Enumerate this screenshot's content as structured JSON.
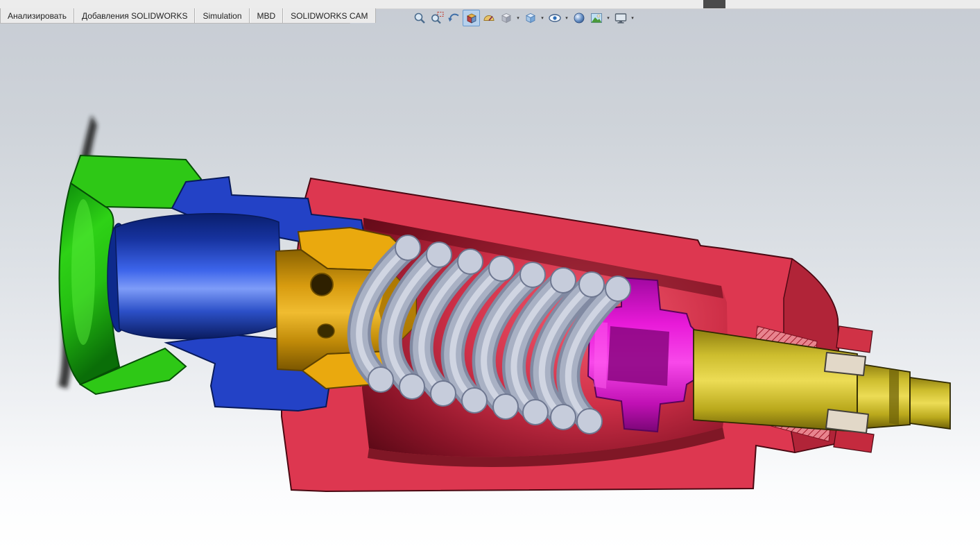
{
  "header": {
    "menubar_fragment": {
      "color": "#4a4a4a"
    },
    "tabs": [
      {
        "label": "Анализировать"
      },
      {
        "label": "Добавления SOLIDWORKS"
      },
      {
        "label": "Simulation"
      },
      {
        "label": "MBD"
      },
      {
        "label": "SOLIDWORKS CAM"
      }
    ]
  },
  "heads_up_toolbar": {
    "items": [
      {
        "name": "zoom-to-fit",
        "active": false
      },
      {
        "name": "zoom-to-area",
        "active": false
      },
      {
        "name": "previous-view",
        "active": false
      },
      {
        "name": "section-view",
        "active": true
      },
      {
        "name": "dynamic-annotation-views",
        "active": false
      },
      {
        "name": "view-orientation",
        "active": false,
        "has_dropdown": true
      },
      {
        "name": "display-style",
        "active": false,
        "has_dropdown": true
      },
      {
        "name": "hide-show-items",
        "active": false,
        "has_dropdown": true
      },
      {
        "name": "edit-appearance",
        "active": false
      },
      {
        "name": "apply-scene",
        "active": false,
        "has_dropdown": true
      },
      {
        "name": "view-settings",
        "active": false,
        "has_dropdown": true
      }
    ],
    "active_bg": "#b5d0ec"
  },
  "viewport": {
    "background_top": "#c7ccd4",
    "background_bottom": "#ffffff",
    "model": {
      "description": "Section view of a valve fitting assembly with internal spring",
      "parts": [
        {
          "name": "end-cap",
          "color": "#2ec816"
        },
        {
          "name": "fitting",
          "color": "#2342c6"
        },
        {
          "name": "piston",
          "color": "#eaa90e"
        },
        {
          "name": "body",
          "color": "#dd3750"
        },
        {
          "name": "spring",
          "color": "#9aa3b8",
          "cut_face_color": "#c6ccdb"
        },
        {
          "name": "spring-seat",
          "color": "#e414d4"
        },
        {
          "name": "stem",
          "color": "#d6c428"
        },
        {
          "name": "seal",
          "color": "#e2d8c8"
        }
      ]
    }
  }
}
